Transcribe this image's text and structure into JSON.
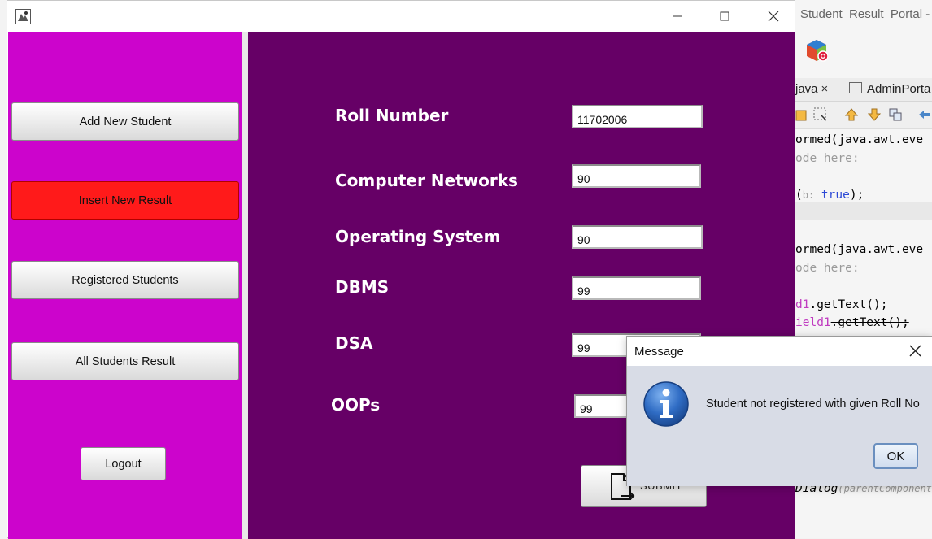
{
  "ide": {
    "title": "Student_Result_Portal - A",
    "tabs": [
      {
        "label": "java",
        "close": "×"
      },
      {
        "label": "AdminPorta"
      }
    ],
    "code_lines": [
      {
        "pre": "ormed(java.awt.eve",
        "kw": "",
        "post": "",
        "style": "normal"
      },
      {
        "pre": "ode here:",
        "kw": "",
        "post": "",
        "style": "gray"
      },
      {
        "pre": "(",
        "param": "b:",
        "kw": " true",
        "post": ");",
        "style": "normal"
      },
      {
        "pre": "ormed(java.awt.eve",
        "kw": "",
        "post": "",
        "style": "normal"
      },
      {
        "pre": "ode here:",
        "kw": "",
        "post": "",
        "style": "gray"
      },
      {
        "pre": "d1",
        "post": ".getText();",
        "style": "pink"
      },
      {
        "pre": "ield1",
        "post": ".getText();",
        "style": "pink-strike"
      },
      {
        "pre": "Dialog",
        "post": "(parentComponent",
        "style": "italic"
      }
    ]
  },
  "window": {
    "sidebar_buttons": [
      {
        "label": "Add New Student",
        "active": false
      },
      {
        "label": "Insert New Result",
        "active": true
      },
      {
        "label": "Registered Students",
        "active": false
      },
      {
        "label": "All Students Result",
        "active": false
      }
    ],
    "logout_label": "Logout",
    "form": {
      "fields": [
        {
          "label": "Roll Number",
          "value": "11702006"
        },
        {
          "label": "Computer Networks",
          "value": "90"
        },
        {
          "label": "Operating System",
          "value": "90"
        },
        {
          "label": "DBMS",
          "value": "99"
        },
        {
          "label": "DSA",
          "value": "99"
        },
        {
          "label": "OOPs",
          "value": "99"
        }
      ],
      "submit_label": "SUBMIT"
    }
  },
  "dialog": {
    "title": "Message",
    "message": "Student not registered with given Roll No",
    "ok_label": "OK",
    "icon": "info-icon"
  },
  "colors": {
    "sidebar": "#cc04cc",
    "form_bg": "#660066",
    "active_button": "#ff1a1a"
  }
}
